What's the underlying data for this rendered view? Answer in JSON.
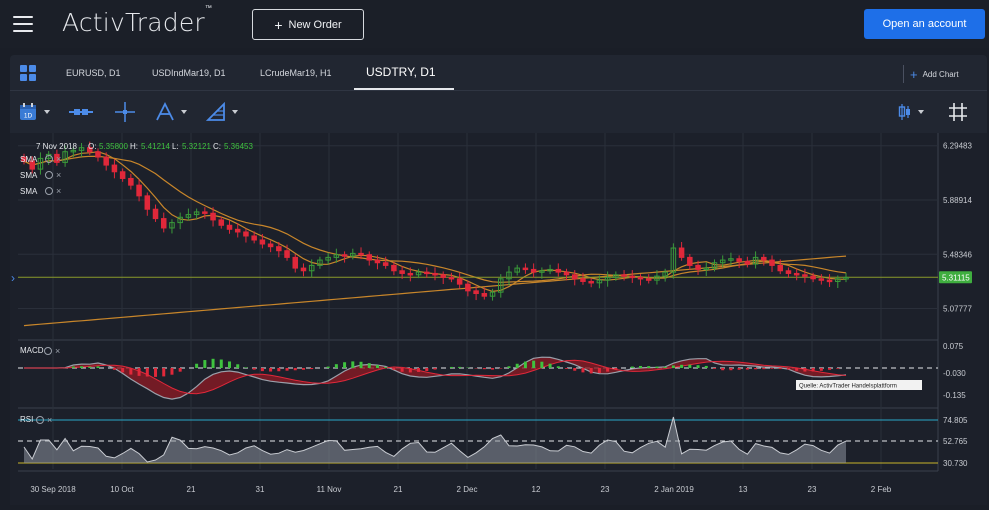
{
  "header": {
    "logo": "ActivTrader",
    "logo_tm": "™",
    "new_order_label": "New Order",
    "open_account_label": "Open an account"
  },
  "tabs": [
    {
      "label": "EURUSD, D1"
    },
    {
      "label": "USDIndMar19, D1"
    },
    {
      "label": "LCrudeMar19, H1"
    },
    {
      "label": "USDTRY, D1",
      "active": true
    }
  ],
  "add_chart_label": "Add Chart",
  "toolbar": {
    "icons": [
      "calendar-icon",
      "line-style-icon",
      "crosshair-icon",
      "drawing-tools-icon",
      "fibonacci-icon",
      "candle-type-icon",
      "grid-toggle-icon"
    ],
    "calendar_badge": "1D"
  },
  "ohlc": {
    "date": "7 Nov 2018",
    "o_label": "O:",
    "o": "5.35800",
    "h_label": "H:",
    "h": "5.41214",
    "l_label": "L:",
    "l": "5.32121",
    "c_label": "C:",
    "c": "5.36453"
  },
  "indicators": {
    "sma_labels": [
      "SMA",
      "SMA",
      "SMA"
    ],
    "macd_label": "MACD",
    "rsi_label": "RSI"
  },
  "watermark": "Quelle: ActivTrader Handelsplattform",
  "colors": {
    "bull": "#3a9a3a",
    "bear": "#e0283a",
    "sma": "#c8862a",
    "current_price_line": "#8a9a2a",
    "price_tag": "#3fae3f",
    "rsi_band": "#2aa8c8",
    "rsi_low": "#c8b42a"
  },
  "chart_data": {
    "type": "candlestick",
    "symbol": "USDTRY, D1",
    "price_axis": {
      "ticks": [
        "6.29483",
        "5.88914",
        "5.48346",
        "5.07777"
      ],
      "min": 4.85,
      "max": 6.33
    },
    "current_price": "5.31115",
    "x_ticks": [
      "30 Sep 2018",
      "10 Oct",
      "21",
      "31",
      "11 Nov",
      "21",
      "2 Dec",
      "12",
      "23",
      "2 Jan 2019",
      "13",
      "23",
      "2 Feb"
    ],
    "closes": [
      6.18,
      6.12,
      6.2,
      6.23,
      6.17,
      6.25,
      6.26,
      6.28,
      6.25,
      6.21,
      6.15,
      6.1,
      6.05,
      6.0,
      5.92,
      5.82,
      5.75,
      5.68,
      5.72,
      5.76,
      5.78,
      5.8,
      5.79,
      5.74,
      5.7,
      5.67,
      5.65,
      5.62,
      5.59,
      5.56,
      5.54,
      5.51,
      5.46,
      5.38,
      5.36,
      5.4,
      5.44,
      5.46,
      5.48,
      5.47,
      5.49,
      5.48,
      5.44,
      5.42,
      5.4,
      5.36,
      5.34,
      5.33,
      5.35,
      5.34,
      5.33,
      5.31,
      5.3,
      5.26,
      5.21,
      5.19,
      5.17,
      5.2,
      5.3,
      5.35,
      5.38,
      5.37,
      5.35,
      5.36,
      5.37,
      5.35,
      5.33,
      5.3,
      5.28,
      5.27,
      5.29,
      5.31,
      5.33,
      5.32,
      5.31,
      5.3,
      5.29,
      5.32,
      5.35,
      5.53,
      5.46,
      5.4,
      5.37,
      5.38,
      5.42,
      5.44,
      5.45,
      5.43,
      5.41,
      5.46,
      5.44,
      5.4,
      5.36,
      5.34,
      5.33,
      5.32,
      5.3,
      5.29,
      5.28,
      5.3,
      5.31
    ],
    "sma_periods": [
      "fast",
      "medium",
      "slow"
    ],
    "macd_axis": {
      "ticks": [
        "0.075",
        "-0.030",
        "-0.135"
      ]
    },
    "rsi_axis": {
      "ticks": [
        "74.805",
        "52.765",
        "30.730"
      ]
    }
  }
}
